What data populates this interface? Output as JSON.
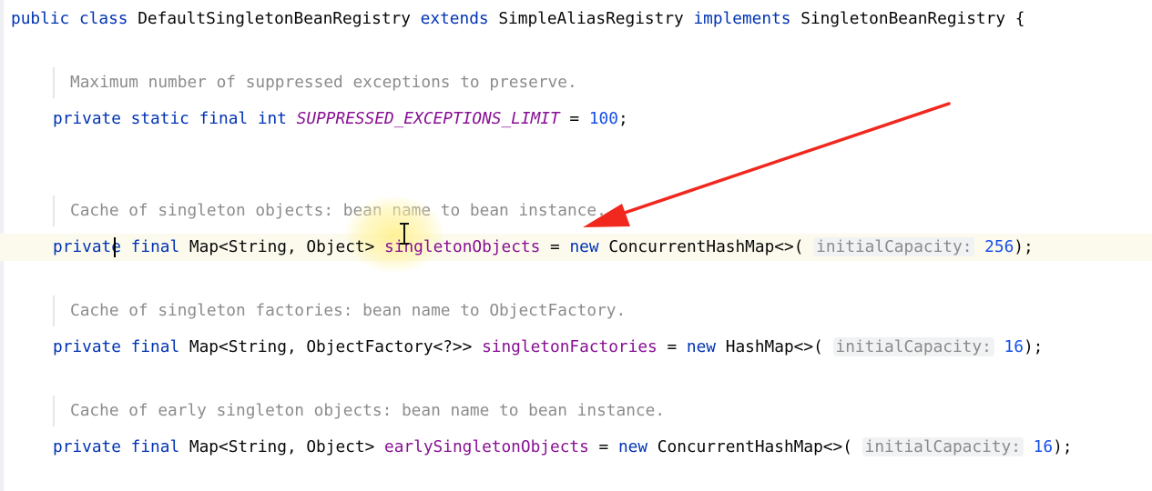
{
  "editor": {
    "class_decl": {
      "kw_public": "public",
      "kw_class": "class",
      "name": "DefaultSingletonBeanRegistry",
      "kw_extends": "extends",
      "superclass": "SimpleAliasRegistry",
      "kw_implements": "implements",
      "iface": "SingletonBeanRegistry",
      "brace": "{"
    },
    "docs": [
      "Maximum number of suppressed exceptions to preserve.",
      "Cache of singleton objects: bean name to bean instance.",
      "Cache of singleton factories: bean name to ObjectFactory.",
      "Cache of early singleton objects: bean name to bean instance."
    ],
    "line1": {
      "mods": "private static final",
      "type": "int",
      "name": "SUPPRESSED_EXCEPTIONS_LIMIT",
      "eq": " = ",
      "value": "100",
      "end": ";"
    },
    "line2": {
      "priv_a": "priva",
      "priv_b": "te",
      "final": "final",
      "type": "Map<String, Object>",
      "name": "singletonObjects",
      "eq": " = ",
      "new": "new",
      "ctor": "ConcurrentHashMap<>(",
      "hint": "initialCapacity:",
      "value": "256",
      "end": ");"
    },
    "line3": {
      "mods": "private final",
      "type": "Map<String, ObjectFactory<?>>",
      "name": "singletonFactories",
      "eq": " = ",
      "new": "new",
      "ctor": "HashMap<>(",
      "hint": "initialCapacity:",
      "value": "16",
      "end": ");"
    },
    "line4": {
      "mods": "private final",
      "type": "Map<String, Object>",
      "name": "earlySingletonObjects",
      "eq": " = ",
      "new": "new",
      "ctor": "ConcurrentHashMap<>(",
      "hint": "initialCapacity:",
      "value": "16",
      "end": ");"
    }
  },
  "annotation": {
    "arrow_color": "#f0281e"
  }
}
